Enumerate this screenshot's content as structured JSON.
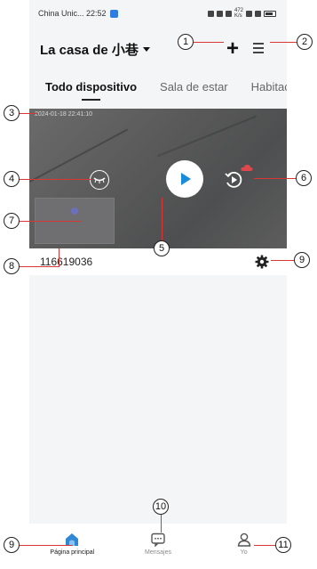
{
  "status_bar": {
    "carrier_time": "China Unic... 22:52",
    "speed": "472 K/s"
  },
  "header": {
    "home_name": "La casa de 小巷"
  },
  "tabs": [
    {
      "label": "Todo dispositivo",
      "active": true
    },
    {
      "label": "Sala de estar",
      "active": false
    },
    {
      "label": "Habitac",
      "active": false
    }
  ],
  "camera": {
    "timestamp": "2024-01-18 22:41:10",
    "device_id": "116619036"
  },
  "bottom_nav": [
    {
      "label": "Página principal",
      "icon": "home-icon",
      "active": true
    },
    {
      "label": "Mensajes",
      "icon": "message-icon",
      "active": false
    },
    {
      "label": "Yo",
      "icon": "user-icon",
      "active": false
    }
  ],
  "callouts": [
    "1",
    "2",
    "3",
    "4",
    "5",
    "6",
    "7",
    "8",
    "9",
    "9",
    "10",
    "11"
  ],
  "colors": {
    "accent": "#1b8ad9",
    "callout_line": "#d93636",
    "cloud_badge": "#e0474c"
  }
}
